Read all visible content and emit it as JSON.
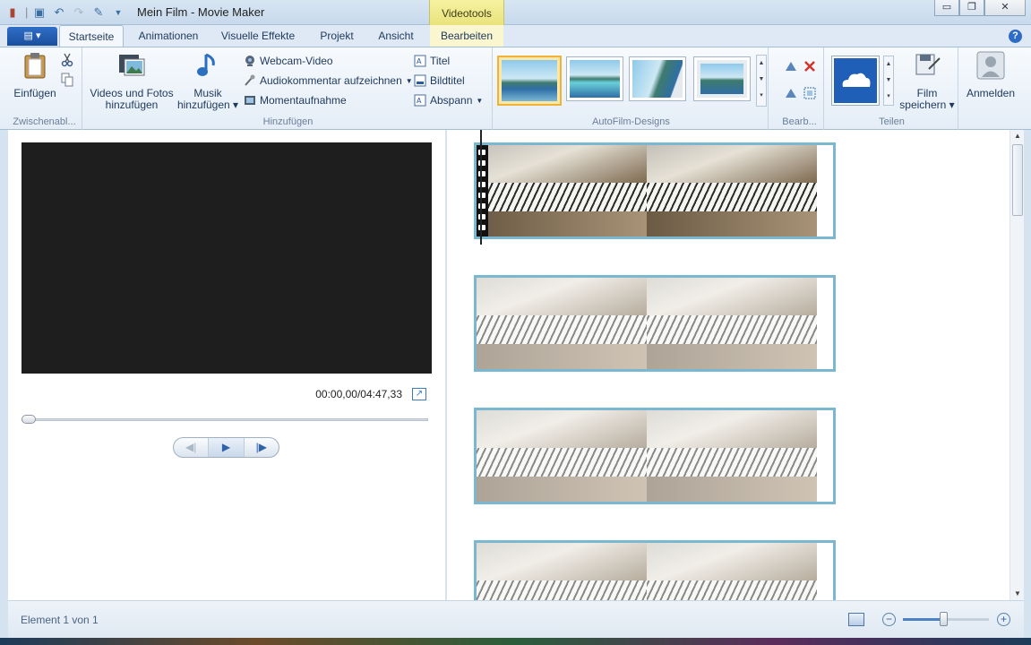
{
  "window": {
    "title": "Mein Film - Movie Maker",
    "context_tab_group": "Videotools",
    "controls": {
      "minimize": "▭",
      "maximize": "❐",
      "close": "✕"
    }
  },
  "ribbon_tabs": {
    "app_menu": "▤ ▾",
    "items": [
      "Startseite",
      "Animationen",
      "Visuelle Effekte",
      "Projekt",
      "Ansicht",
      "Bearbeiten"
    ],
    "active": "Startseite",
    "help": "?"
  },
  "ribbon": {
    "clipboard": {
      "label": "Zwischenabl...",
      "paste": "Einfügen"
    },
    "add": {
      "label": "Hinzufügen",
      "videos_photos": [
        "Videos und Fotos",
        "hinzufügen"
      ],
      "music": [
        "Musik",
        "hinzufügen ▾"
      ],
      "webcam": "Webcam-Video",
      "narration": "Audiokommentar aufzeichnen",
      "snapshot": "Momentaufnahme",
      "title": "Titel",
      "caption": "Bildtitel",
      "credits": "Abspann"
    },
    "themes": {
      "label": "AutoFilm-Designs"
    },
    "edit": {
      "label": "Bearb..."
    },
    "share": {
      "label": "Teilen",
      "save_movie": [
        "Film",
        "speichern ▾"
      ]
    },
    "signin": "Anmelden"
  },
  "preview": {
    "timecode": "00:00,00/04:47,33",
    "seek_position": 0
  },
  "storyboard": {
    "clip_count": 4,
    "selected_clip": 1
  },
  "status": {
    "text": "Element 1 von 1",
    "zoom_out": "−",
    "zoom_in": "+"
  },
  "colors": {
    "ribbon_bg": "#e4edf7",
    "context_tab": "#e9e27c",
    "clip_border": "#7ab8d1",
    "preview_screen": "#1e1e1e",
    "onedrive_tile": "#1f5fb8"
  }
}
